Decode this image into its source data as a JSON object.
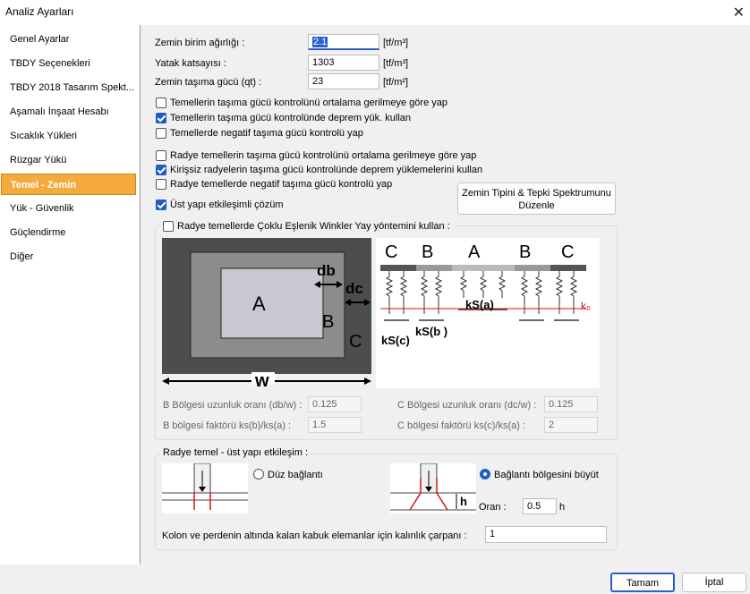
{
  "window": {
    "title": "Analiz Ayarları"
  },
  "sidebar": {
    "items": [
      {
        "label": "Genel Ayarlar",
        "active": false
      },
      {
        "label": "TBDY Seçenekleri",
        "active": false
      },
      {
        "label": "TBDY 2018 Tasarım Spekt...",
        "active": false
      },
      {
        "label": "Aşamalı İnşaat Hesabı",
        "active": false
      },
      {
        "label": "Sıcaklık Yükleri",
        "active": false
      },
      {
        "label": "Rüzgar Yükü",
        "active": false
      },
      {
        "label": "Temel - Zemin",
        "active": true
      },
      {
        "label": "Yük - Güvenlik",
        "active": false
      },
      {
        "label": "Güçlendirme",
        "active": false
      },
      {
        "label": "Diğer",
        "active": false
      }
    ]
  },
  "fields": {
    "unit_weight": {
      "label": "Zemin birim ağırlığı :",
      "value": "2.1",
      "unit": "[tf/m³]"
    },
    "bed_coefficient": {
      "label": "Yatak katsayısı :",
      "value": "1303",
      "unit": "[tf/m³]"
    },
    "bearing_capacity": {
      "label": "Zemin taşıma gücü (qt) :",
      "value": "23",
      "unit": "[tf/m²]"
    }
  },
  "checkboxes": {
    "cb1": {
      "label": "Temellerin taşıma gücü kontrolünü ortalama gerilmeye göre yap",
      "checked": false
    },
    "cb2": {
      "label": "Temellerin taşıma gücü kontrolünde deprem yük. kullan",
      "checked": true
    },
    "cb3": {
      "label": "Temellerde negatif taşıma gücü kontrolü yap",
      "checked": false
    },
    "cb4": {
      "label": "Radye temellerin taşıma gücü kontrolünü ortalama gerilmeye göre yap",
      "checked": false
    },
    "cb5": {
      "label": "Kirişsiz radyelerin taşıma gücü kontrolünde deprem yüklemelerini kullan",
      "checked": true
    },
    "cb6": {
      "label": "Radye temellerde negatif taşıma gücü kontrolü yap",
      "checked": false
    },
    "cb7": {
      "label": "Üst yapı etkileşimli çözüm",
      "checked": true
    }
  },
  "spectrum_button": {
    "line1": "Zemin Tipini  & Tepki Spektrumunu",
    "line2": "Düzenle"
  },
  "winkler": {
    "checkbox_label": "Radye temellerde Çoklu Eşlenik Winkler Yay yöntemini kullan :",
    "checked": false,
    "diagram": {
      "zone_a": "A",
      "zone_b": "B",
      "zone_c": "C",
      "db": "db",
      "dc": "dc",
      "w": "w",
      "ks_a": "kS(a)",
      "ks_b": "kS(b )",
      "ks_c": "kS(c)",
      "k0": "k₀"
    },
    "b_ratio": {
      "label": "B Bölgesi uzunluk oranı (db/w) :",
      "value": "0.125"
    },
    "c_ratio": {
      "label": "C Bölgesi uzunluk oranı (dc/w) :",
      "value": "0.125"
    },
    "b_factor": {
      "label": "B bölgesi faktörü ks(b)/ks(a) :",
      "value": "1.5"
    },
    "c_factor": {
      "label": "C bölgesi faktörü ks(c)/ks(a) :",
      "value": "2"
    }
  },
  "interaction": {
    "group_label": "Radye temel - üst yapı etkileşim :",
    "radio_plain": {
      "label": "Düz bağlantı",
      "selected": false
    },
    "radio_enlarge": {
      "label": "Bağlantı bölgesini büyüt",
      "selected": true
    },
    "h_label": "h",
    "ratio": {
      "label": "Oran :",
      "value": "0.5",
      "unit": "h"
    },
    "thickness": {
      "label": "Kolon ve perdenin altında kalan kabuk elemanlar için kalınlık çarpanı :",
      "value": "1"
    }
  },
  "footer": {
    "ok": "Tamam",
    "cancel": "İptal"
  },
  "colors": {
    "accent": "#f4aa3c",
    "focus": "#2b5fcc",
    "checkbox": "#1f5fbf"
  },
  "icons": {
    "close": "close-icon"
  }
}
